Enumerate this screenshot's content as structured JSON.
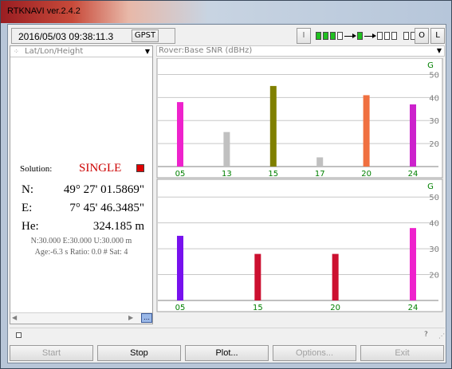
{
  "window": {
    "title": "RTKNAVI ver.2.4.2"
  },
  "toolbar": {
    "time": "2016/05/03 09:38:11.3",
    "time_system": "GPST",
    "input_button": "I",
    "output_button": "O",
    "log_button": "L"
  },
  "stream_status": [
    "on",
    "on",
    "on",
    "off",
    "line",
    "on",
    "line",
    "off",
    "off",
    "off",
    "space",
    "off",
    "off"
  ],
  "left_panel": {
    "header": "Lat/Lon/Height",
    "solution_label": "Solution:",
    "solution_value": "SINGLE",
    "solution_color": "#e00000",
    "lat_label": "N:",
    "lat_value": "49° 27' 01.5869\"",
    "lon_label": "E:",
    "lon_value": "7° 45' 46.3485\"",
    "height_label": "He:",
    "height_value": "324.185 m",
    "stdev": "N:30.000 E:30.000 U:30.000 m",
    "age_ratio": "Age:-6.3 s Ratio: 0.0 # Sat: 4"
  },
  "right_panel": {
    "header": "Rover:Base SNR (dBHz)"
  },
  "chart_data": [
    {
      "type": "bar",
      "title": "G",
      "categories": [
        "05",
        "13",
        "15",
        "17",
        "20",
        "24"
      ],
      "values": [
        38,
        25,
        45,
        14,
        41,
        37
      ],
      "colors": [
        "#ee22cc",
        "#c0c0c0",
        "#808000",
        "#c0c0c0",
        "#f07040",
        "#cc22cc"
      ],
      "yticks": [
        20,
        30,
        40,
        50
      ],
      "ylim": [
        10,
        55
      ],
      "grid": true
    },
    {
      "type": "bar",
      "title": "G",
      "categories": [
        "05",
        "15",
        "20",
        "24"
      ],
      "values": [
        35,
        28,
        28,
        38
      ],
      "colors": [
        "#7711ee",
        "#cc1030",
        "#cc1030",
        "#ee22cc"
      ],
      "yticks": [
        20,
        30,
        40,
        50
      ],
      "ylim": [
        10,
        55
      ],
      "grid": true
    }
  ],
  "buttons": {
    "start": "Start",
    "stop": "Stop",
    "plot": "Plot...",
    "options": "Options...",
    "exit": "Exit"
  }
}
